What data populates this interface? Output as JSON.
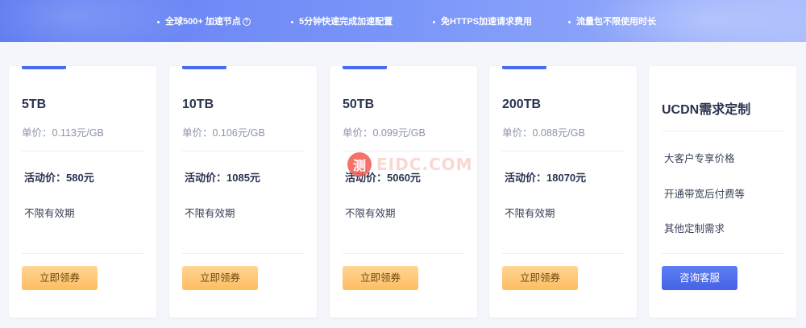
{
  "banner": {
    "features": [
      {
        "text": "全球500+ 加速节点",
        "has_help": true
      },
      {
        "text": "5分钟快速完成加速配置",
        "has_help": false
      },
      {
        "text": "免HTTPS加速请求费用",
        "has_help": false
      },
      {
        "text": "流量包不限使用时长",
        "has_help": false
      }
    ],
    "help_icon": "question-circle-icon",
    "colors": {
      "start": "#5a78f0",
      "end": "#a9bcfd"
    }
  },
  "plans": [
    {
      "name": "5TB",
      "unit_price": "单价：0.113元/GB",
      "promo": "活动价：580元",
      "term": "不限有效期",
      "button": "立即领券"
    },
    {
      "name": "10TB",
      "unit_price": "单价：0.106元/GB",
      "promo": "活动价：1085元",
      "term": "不限有效期",
      "button": "立即领券"
    },
    {
      "name": "50TB",
      "unit_price": "单价：0.099元/GB",
      "promo": "活动价：5060元",
      "term": "不限有效期",
      "button": "立即领券"
    },
    {
      "name": "200TB",
      "unit_price": "单价：0.088元/GB",
      "promo": "活动价：18070元",
      "term": "不限有效期",
      "button": "立即领券"
    }
  ],
  "custom": {
    "name": "UCDN需求定制",
    "perks": [
      "大客户专享价格",
      "开通带宽后付费等",
      "其他定制需求"
    ],
    "button": "咨询客服"
  },
  "watermark": {
    "badge": "测",
    "text": "EIDC.COM"
  },
  "colors": {
    "accent_bar": "#4a6cf0",
    "coupon_button": "#fdbd63",
    "service_button": "#4463e6",
    "text_dark": "#2b3351",
    "text_muted": "#8a93a8"
  }
}
